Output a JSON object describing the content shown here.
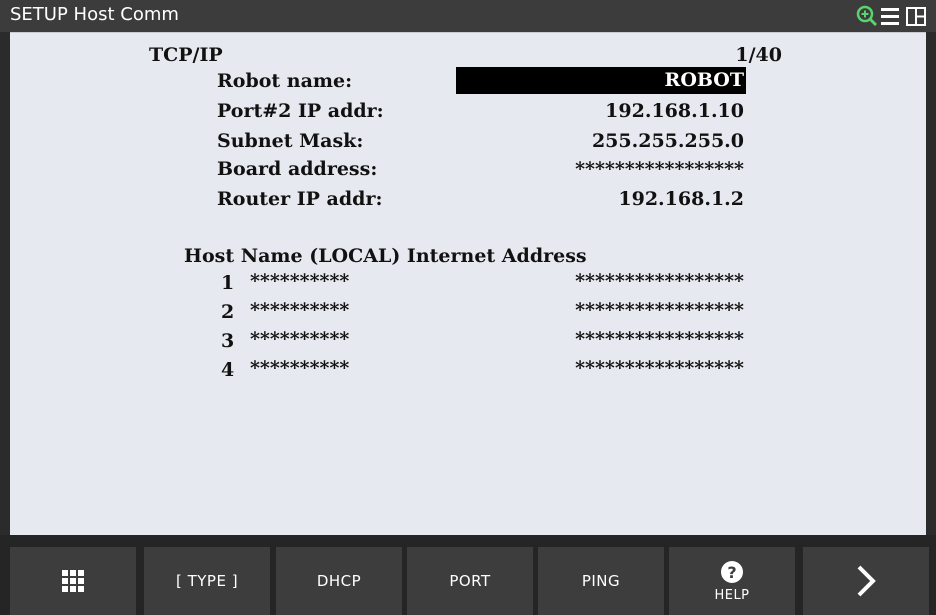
{
  "window": {
    "title": "SETUP Host Comm",
    "icons": [
      "zoom-in-icon",
      "menu-icon",
      "layout-icon"
    ],
    "accent_zoom": "#59d36b"
  },
  "screen": {
    "section": "TCP/IP",
    "page_indicator": "1/40",
    "fields": [
      {
        "label": "Robot name:",
        "value": "ROBOT",
        "selected": true
      },
      {
        "label": "Port#2 IP addr:",
        "value": "192.168.1.10"
      },
      {
        "label": "Subnet Mask:",
        "value": "255.255.255.0"
      },
      {
        "label": "Board address:",
        "value": "*****************"
      },
      {
        "label": "Router IP addr:",
        "value": "192.168.1.2"
      }
    ],
    "hosts_header": "Host Name (LOCAL) Internet Address",
    "hosts": [
      {
        "num": "1",
        "name": "**********",
        "address": "*****************"
      },
      {
        "num": "2",
        "name": "**********",
        "address": "*****************"
      },
      {
        "num": "3",
        "name": "**********",
        "address": "*****************"
      },
      {
        "num": "4",
        "name": "**********",
        "address": "*****************"
      }
    ]
  },
  "softkeys": {
    "menu_icon": "grid-menu-icon",
    "type": "[ TYPE ]",
    "dhcp": "DHCP",
    "port": "PORT",
    "ping": "PING",
    "help": "HELP",
    "help_icon": "help-icon",
    "next_icon": "chevron-right-icon"
  }
}
